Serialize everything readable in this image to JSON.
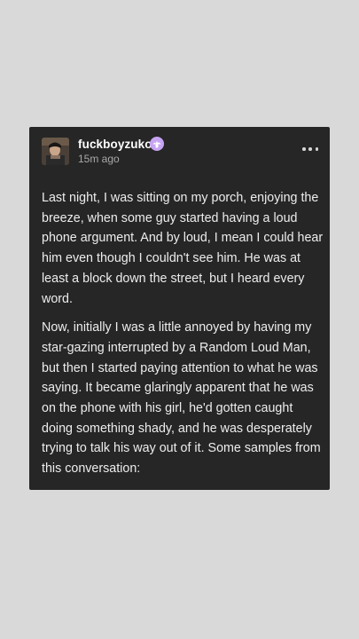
{
  "post": {
    "username": "fuckboyzuko",
    "timestamp": "15m ago",
    "badge_icon": "mushroom-badge-icon",
    "menu_icon": "more-options-icon",
    "paragraphs": [
      "Last night, I was sitting on my porch, enjoying the breeze, when some guy started having a loud phone argument. And by loud, I mean I could hear him even though I couldn't see him. He was at least a block down the street, but I heard every word.",
      "Now, initially I was a little annoyed by having my star-gazing interrupted by a Random Loud Man, but then I started paying attention to what he was saying. It became glaringly apparent that he was on the phone with his girl, he'd gotten caught doing something shady, and he was desperately trying to talk his way out of it. Some samples from this conversation:"
    ]
  },
  "colors": {
    "page_bg": "#d9d9d9",
    "card_bg": "#262626",
    "text": "#ededed",
    "muted": "#a8a8a8",
    "badge": "#c7a4f2"
  }
}
